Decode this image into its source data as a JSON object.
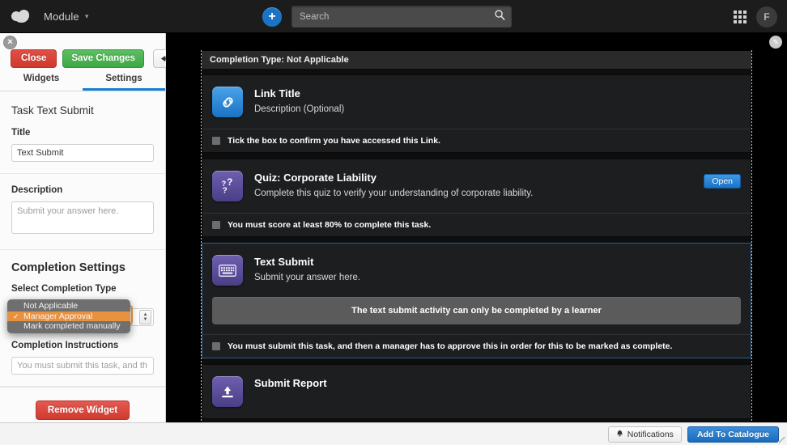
{
  "topnav": {
    "brand": "Module",
    "brand_caret": "▾",
    "plus_label": "+",
    "search_placeholder": "Search",
    "search_icon": "⌕",
    "avatar_initial": "F"
  },
  "left_panel": {
    "close_label": "×",
    "buttons": {
      "close": "Close",
      "save": "Save Changes",
      "undo": "↰",
      "redo": "↱"
    },
    "tabs": [
      {
        "label": "Widgets",
        "active": false
      },
      {
        "label": "Settings",
        "active": true
      }
    ],
    "section_title": "Task Text Submit",
    "fields": {
      "title_label": "Title",
      "title_value": "Text Submit",
      "description_label": "Description",
      "description_placeholder": "Submit your answer here.",
      "description_value": "",
      "completion_heading": "Completion Settings",
      "completion_type_label": "Select Completion Type",
      "completion_type_value": "Manager Approval",
      "instructions_label": "Completion Instructions",
      "instructions_placeholder": "You must submit this task, and th",
      "instructions_value": ""
    },
    "dropdown": {
      "open": true,
      "options": [
        {
          "label": "Not Applicable",
          "selected": false
        },
        {
          "label": "Manager Approval",
          "selected": true
        },
        {
          "label": "Mark completed manually",
          "selected": false
        }
      ]
    },
    "remove_button": "Remove Widget",
    "edit_icon": "✎"
  },
  "canvas": {
    "completion_type_bar": "Completion Type: Not Applicable",
    "widgets": [
      {
        "icon": "link-icon",
        "icon_glyph": "⛓",
        "title": "Link Title",
        "description": "Description (Optional)",
        "action_label": "",
        "notice": "",
        "footer": "Tick the box to confirm you have accessed this Link.",
        "selected": false
      },
      {
        "icon": "quiz-icon",
        "icon_glyph": "?",
        "title": "Quiz: Corporate Liability",
        "description": "Complete this quiz to verify your understanding of corporate liability.",
        "action_label": "Open",
        "notice": "",
        "footer": "You must score at least 80% to complete this task.",
        "selected": false
      },
      {
        "icon": "keyboard-icon",
        "icon_glyph": "⌨",
        "title": "Text Submit",
        "description": "Submit your answer here.",
        "action_label": "",
        "notice": "The text submit activity can only be completed by a learner",
        "footer": "You must submit this task, and then a manager has to approve this in order for this to be marked as complete.",
        "selected": true
      },
      {
        "icon": "upload-icon",
        "icon_glyph": "⬆",
        "title": "Submit Report",
        "description": "",
        "action_label": "",
        "notice": "",
        "footer": "",
        "selected": false
      }
    ]
  },
  "bottombar": {
    "notifications_label": "Notifications",
    "notifications_icon": "🔔",
    "catalogue_label": "Add To Catalogue"
  },
  "colors": {
    "accent_blue": "#1a72c4",
    "save_green": "#3ea844",
    "danger_red": "#cf3a30",
    "highlight_orange": "#e8913f"
  }
}
